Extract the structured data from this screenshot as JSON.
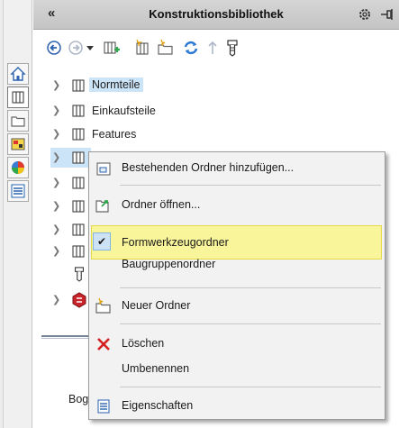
{
  "window": {
    "title": "Konstruktionsbibliothek",
    "collapse_glyph": "«"
  },
  "toolbar": {
    "icons": [
      "back-arrow-icon",
      "forward-arrow-icon",
      "dropdown-arrow-icon",
      "add-library-icon",
      "new-library-icon",
      "new-folder-icon",
      "refresh-icon",
      "up-arrow-icon",
      "part-icon"
    ]
  },
  "tree": {
    "items": [
      {
        "label": "Normteile",
        "selected": true
      },
      {
        "label": "Einkaufsteile",
        "selected": false
      },
      {
        "label": "Features",
        "selected": false
      }
    ],
    "partial_label": "Bog"
  },
  "context_menu": {
    "items": [
      {
        "label": "Bestehenden Ordner hinzufügen...",
        "icon": "add-existing-folder-icon"
      },
      {
        "label": "Ordner öffnen...",
        "icon": "open-folder-icon"
      },
      {
        "label": "Formwerkzeugordner",
        "icon": "check-icon",
        "checked": true
      },
      {
        "label": "Baugruppenordner",
        "icon": ""
      },
      {
        "label": "Neuer Ordner",
        "icon": "new-folder-icon"
      },
      {
        "label": "Löschen",
        "icon": "delete-icon"
      },
      {
        "label": "Umbenennen",
        "icon": ""
      },
      {
        "label": "Eigenschaften",
        "icon": "properties-icon"
      }
    ],
    "check_glyph": "✔"
  },
  "colors": {
    "highlight": "#f9f59a",
    "selection": "#cce4f7",
    "delete_red": "#d42020",
    "refresh_blue": "#2a78d4"
  }
}
